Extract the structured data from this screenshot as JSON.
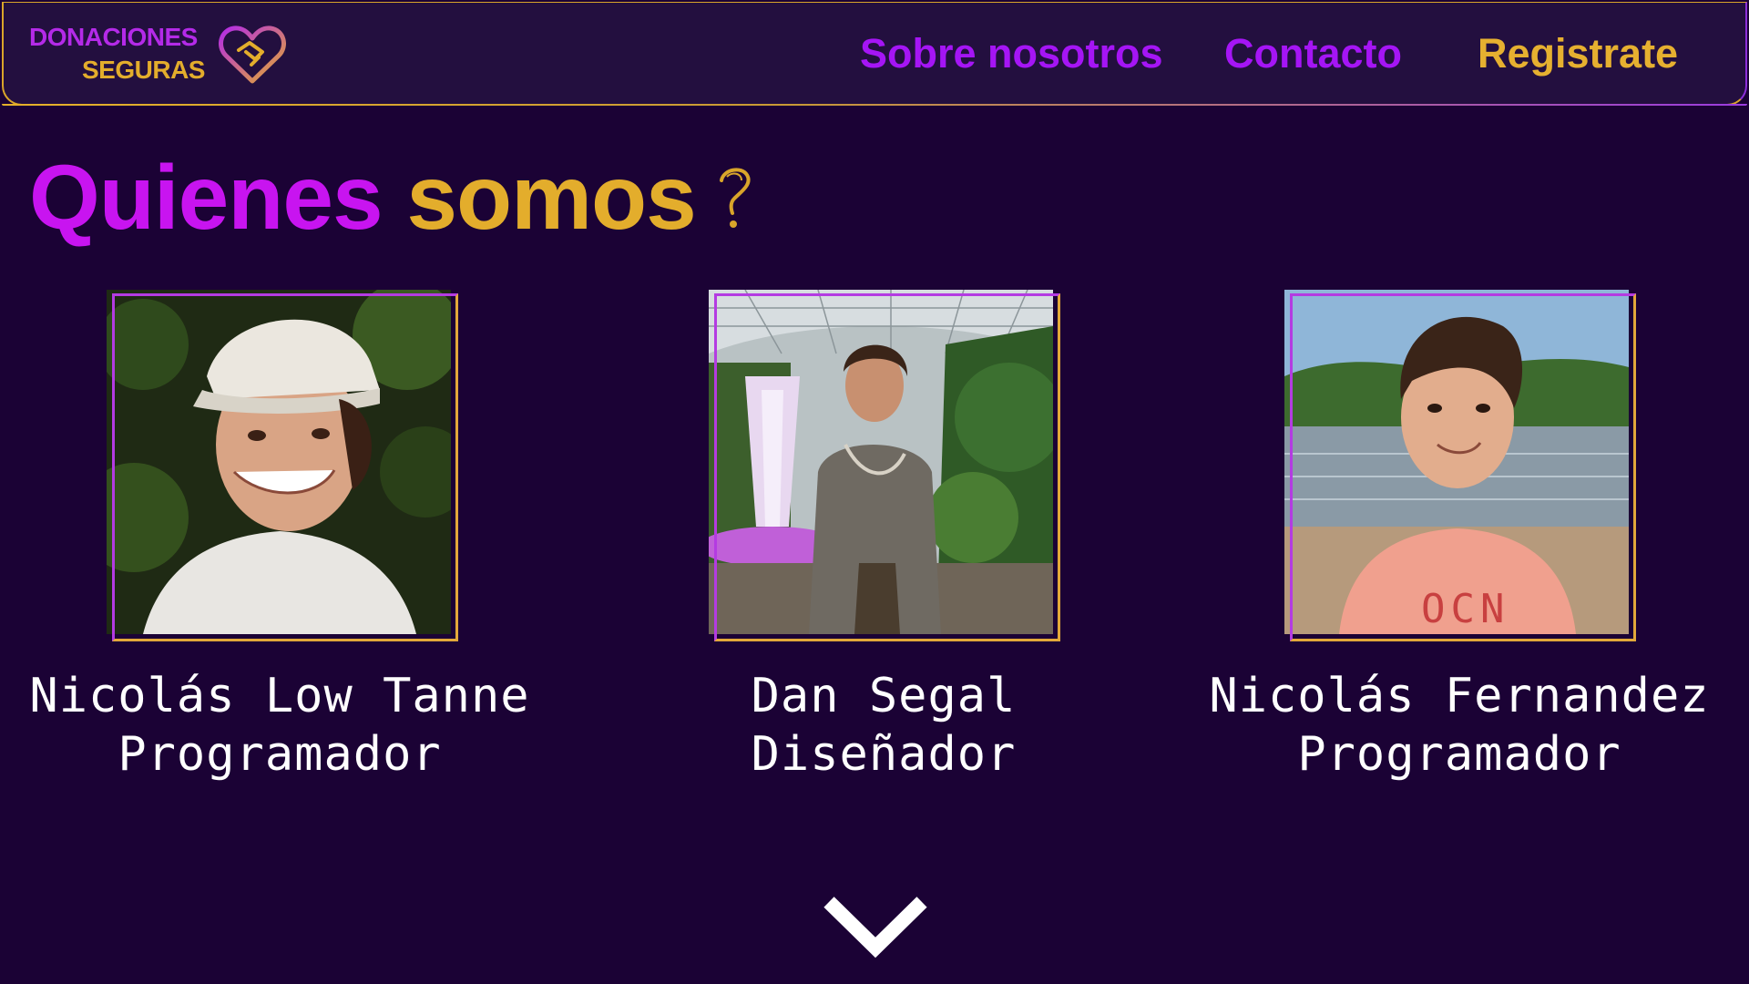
{
  "header": {
    "logo": {
      "line1": "DONACIONES",
      "line2": "SEGURAS",
      "icon": "heart-handshake-icon"
    },
    "nav": [
      {
        "label": "Sobre nosotros"
      },
      {
        "label": "Contacto"
      },
      {
        "label": "Registrate"
      }
    ]
  },
  "main": {
    "heading": {
      "word1": "Quienes",
      "word2": "somos"
    },
    "members": [
      {
        "name": "Nicolás Low Tanne",
        "role": "Programador"
      },
      {
        "name": "Dan Segal",
        "role": "Diseñador"
      },
      {
        "name": "Nicolás Fernandez",
        "role": "Programador"
      }
    ],
    "scroll_icon": "chevron-down-icon"
  },
  "colors": {
    "background": "#1b0235",
    "navbar": "#230f3f",
    "purple": "#c814f0",
    "gold": "#e3ad2c",
    "text": "#ffffff"
  }
}
